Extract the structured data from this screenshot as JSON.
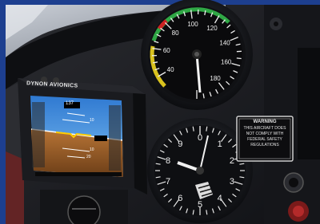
{
  "device": {
    "brand": "DYNON AVIONICS",
    "heading_box": "137",
    "attitude_labels": [
      "10",
      "10",
      "20"
    ]
  },
  "airspeed_indicator": {
    "scale_numbers": [
      "40",
      "60",
      "80",
      "100",
      "120",
      "140",
      "160",
      "180"
    ]
  },
  "altimeter": {
    "scale_numbers": [
      "0",
      "1",
      "2",
      "3",
      "4",
      "5",
      "6",
      "7",
      "8",
      "9"
    ]
  },
  "placard": {
    "heading": "WARNING",
    "lines": [
      "THIS AIRCRAFT DOES",
      "NOT COMPLY WITH",
      "FEDERAL SAFETY",
      "REGULATIONS"
    ]
  },
  "colors": {
    "frame_blue": "#1d3f8f",
    "panel": "#18191d",
    "screen_sky": "#4a9be6",
    "screen_ground": "#a0622e",
    "arc_green": "#2fa845",
    "arc_yellow": "#d9c21e",
    "arc_red": "#cc2222"
  }
}
